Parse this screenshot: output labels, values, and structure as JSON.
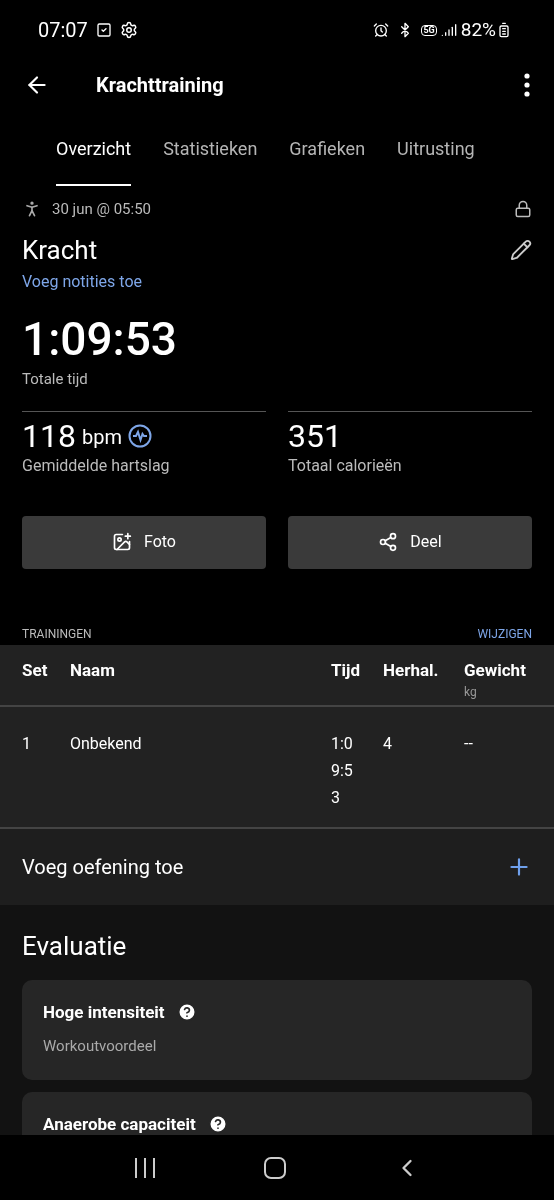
{
  "status_bar": {
    "time": "07:07",
    "battery": "82%",
    "network": "5G"
  },
  "toolbar": {
    "title": "Krachttraining"
  },
  "tabs": [
    {
      "label": "Overzicht",
      "selected": true
    },
    {
      "label": "Statistieken",
      "selected": false
    },
    {
      "label": "Grafieken",
      "selected": false
    },
    {
      "label": "Uitrusting",
      "selected": false
    }
  ],
  "activity": {
    "date": "30 jun @ 05:50",
    "name": "Kracht",
    "notes_link": "Voeg notities toe"
  },
  "total": {
    "value": "1:09:53",
    "label": "Totale tijd"
  },
  "metrics": [
    {
      "kind": "heart",
      "value": "118",
      "unit": "bpm",
      "label": "Gemiddelde hartslag"
    },
    {
      "kind": "plain",
      "value": "351",
      "label": "Totaal calorieën"
    }
  ],
  "buttons": [
    {
      "kind": "photo",
      "label": "Foto"
    },
    {
      "kind": "share",
      "label": "Deel"
    }
  ],
  "trainings": {
    "title": "TRAININGEN",
    "action": "WIJZIGEN",
    "columns": [
      {
        "label": "Set"
      },
      {
        "label": "Naam"
      },
      {
        "label": "Tijd"
      },
      {
        "label": "Herhal."
      },
      {
        "label": "Gewicht",
        "unit": "kg"
      }
    ],
    "rows": [
      [
        "1",
        "Onbekend",
        "1:09:53",
        "4",
        "--"
      ]
    ]
  },
  "add_exercise": {
    "label": "Voeg oefening toe"
  },
  "evaluation": {
    "title": "Evaluatie",
    "cards": [
      {
        "title": "Hoge intensiteit",
        "subtitle": "Workoutvoordeel"
      },
      {
        "title": "Anaerobe capaciteit"
      }
    ]
  }
}
